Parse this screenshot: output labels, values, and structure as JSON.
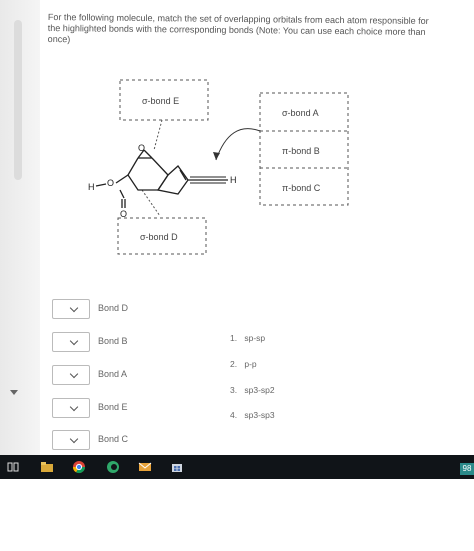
{
  "question": {
    "text": "For the following molecule, match the set of overlapping orbitals from each atom responsible for the highlighted bonds with the corresponding bonds (Note: You can use each choice more than once)"
  },
  "diagram": {
    "labels": {
      "sigma_e": "σ-bond  E",
      "sigma_a": "σ-bond  A",
      "pi_b": "π-bond  B",
      "pi_c": "π-bond  C",
      "sigma_d": "σ-bond  D"
    },
    "atoms": {
      "o_epoxide": "O",
      "h_left": "H",
      "o_hydroxyl": "O",
      "o_carbonyl": "O",
      "h_right": "H"
    }
  },
  "match_rows": [
    {
      "label": "Bond D"
    },
    {
      "label": "Bond B"
    },
    {
      "label": "Bond A"
    },
    {
      "label": "Bond E"
    },
    {
      "label": "Bond C"
    }
  ],
  "answers": [
    {
      "num": "1.",
      "text": "sp-sp"
    },
    {
      "num": "2.",
      "text": "p-p"
    },
    {
      "num": "3.",
      "text": "sp3-sp2"
    },
    {
      "num": "4.",
      "text": "sp3-sp3"
    }
  ],
  "taskbar": {
    "badge": "98",
    "icons": [
      "task-view-icon",
      "file-explorer-icon",
      "chrome-icon",
      "edge-icon",
      "mail-icon",
      "store-icon"
    ]
  }
}
